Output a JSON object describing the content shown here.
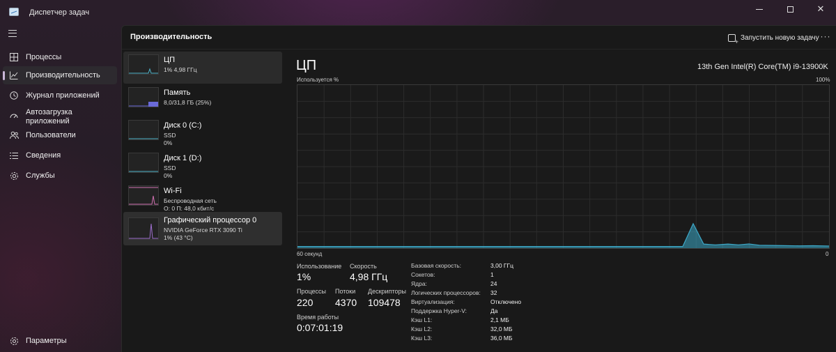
{
  "window": {
    "title": "Диспетчер задач"
  },
  "nav": {
    "items": [
      {
        "label": "Процессы",
        "icon": "processes-icon"
      },
      {
        "label": "Производительность",
        "icon": "performance-icon"
      },
      {
        "label": "Журнал приложений",
        "icon": "app-history-icon"
      },
      {
        "label": "Автозагрузка\nприложений",
        "icon": "startup-icon"
      },
      {
        "label": "Пользователи",
        "icon": "users-icon"
      },
      {
        "label": "Сведения",
        "icon": "details-icon"
      },
      {
        "label": "Службы",
        "icon": "services-icon"
      }
    ],
    "settings_label": "Параметры"
  },
  "header": {
    "title": "Производительность",
    "run_task_label": "Запустить новую задачу",
    "more_label": "···"
  },
  "devices": [
    {
      "name": "ЦП",
      "sub1": "1% 4,98 ГГц",
      "sub2": "",
      "color": "#4fb3c9"
    },
    {
      "name": "Память",
      "sub1": "8,0/31,8 ГБ (25%)",
      "sub2": "",
      "color": "#7a7ae0"
    },
    {
      "name": "Диск 0 (C:)",
      "sub1": "SSD",
      "sub2": "0%",
      "color": "#4fb3c9"
    },
    {
      "name": "Диск 1 (D:)",
      "sub1": "SSD",
      "sub2": "0%",
      "color": "#4fb3c9"
    },
    {
      "name": "Wi-Fi",
      "sub1": "Беспроводная сеть",
      "sub2": "О: 0 П: 48,0 кбит/с",
      "color": "#d070b0"
    },
    {
      "name": "Графический процессор 0",
      "sub1": "NVIDIA GeForce RTX 3090 Ti",
      "sub2": "1% (43 °C)",
      "color": "#a070d0"
    }
  ],
  "cpu": {
    "title": "ЦП",
    "model": "13th Gen Intel(R) Core(TM) i9-13900K",
    "graph_ylabel": "Используется %",
    "graph_ymax": "100%",
    "graph_xleft": "60 секунд",
    "graph_xright": "0",
    "accent": "#3da9c9",
    "stats": {
      "usage_label": "Использование",
      "usage_value": "1%",
      "speed_label": "Скорость",
      "speed_value": "4,98 ГГц",
      "processes_label": "Процессы",
      "processes_value": "220",
      "threads_label": "Потоки",
      "threads_value": "4370",
      "handles_label": "Дескрипторы",
      "handles_value": "109478",
      "uptime_label": "Время работы",
      "uptime_value": "0:07:01:19"
    },
    "details": [
      {
        "key": "Базовая скорость:",
        "value": "3,00 ГГц"
      },
      {
        "key": "Сокетов:",
        "value": "1"
      },
      {
        "key": "Ядра:",
        "value": "24"
      },
      {
        "key": "Логических процессоров:",
        "value": "32"
      },
      {
        "key": "Виртуализация:",
        "value": "Отключено"
      },
      {
        "key": "Поддержка Hyper-V:",
        "value": "Да"
      },
      {
        "key": "Кэш L1:",
        "value": "2,1 МБ"
      },
      {
        "key": "Кэш L2:",
        "value": "32,0 МБ"
      },
      {
        "key": "Кэш L3:",
        "value": "36,0 МБ"
      }
    ]
  }
}
